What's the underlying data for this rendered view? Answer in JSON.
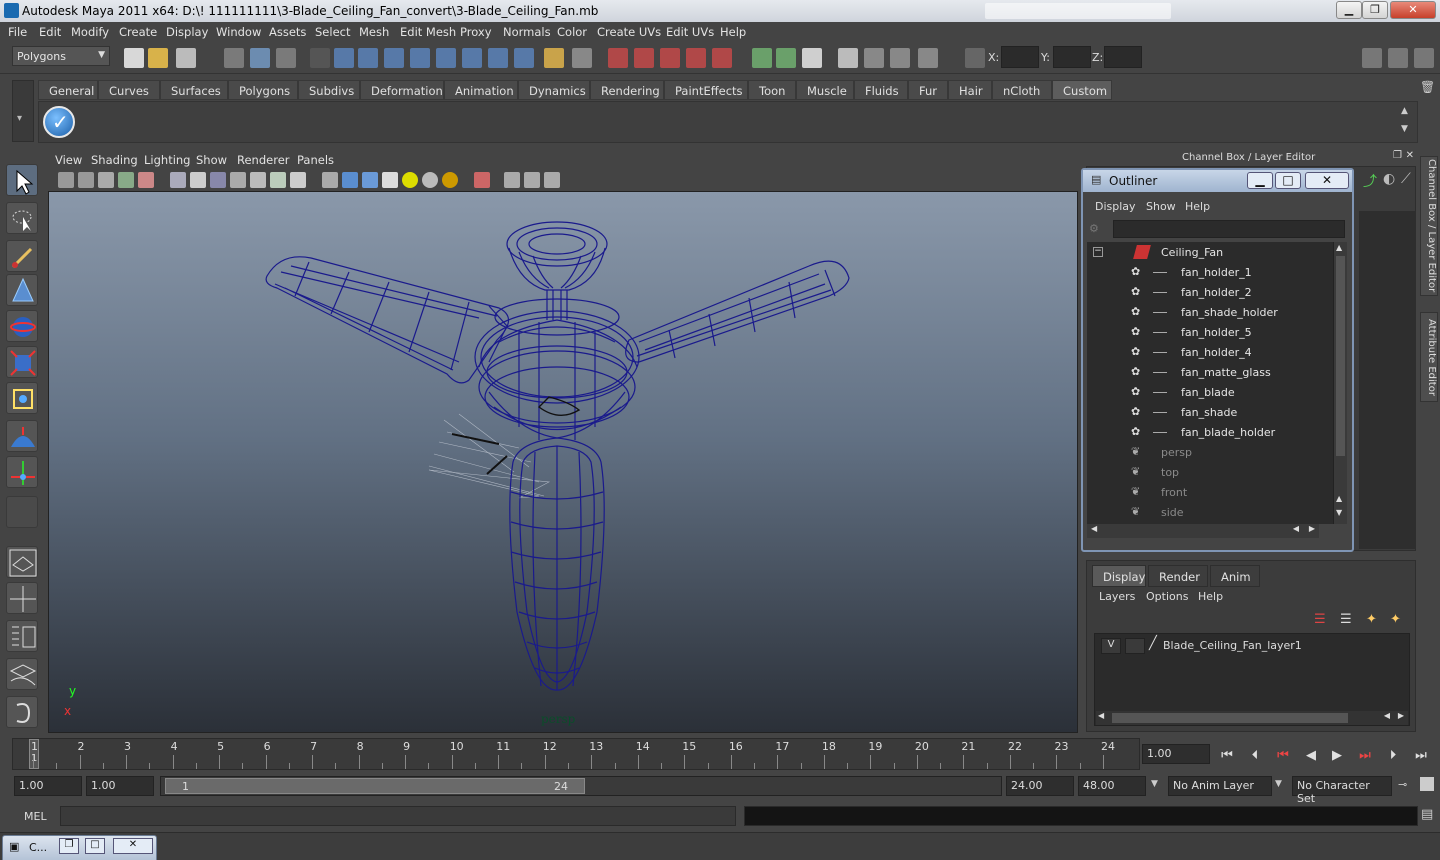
{
  "window": {
    "title": "Autodesk Maya 2011 x64: D:\\! 111111111\\3-Blade_Ceiling_Fan_convert\\3-Blade_Ceiling_Fan.mb",
    "minimize": "▁",
    "maximize": "❐",
    "close": "✕"
  },
  "menubar": [
    "File",
    "Edit",
    "Modify",
    "Create",
    "Display",
    "Window",
    "Assets",
    "Select",
    "Mesh",
    "Edit Mesh",
    "Proxy",
    "Normals",
    "Color",
    "Create UVs",
    "Edit UVs",
    "Help"
  ],
  "statusline": {
    "mode_menu": "Polygons",
    "x_label": "X:",
    "y_label": "Y:",
    "z_label": "Z:"
  },
  "shelf": {
    "tabs": [
      "General",
      "Curves",
      "Surfaces",
      "Polygons",
      "Subdivs",
      "Deformation",
      "Animation",
      "Dynamics",
      "Rendering",
      "PaintEffects",
      "Toon",
      "Muscle",
      "Fluids",
      "Fur",
      "Hair",
      "nCloth",
      "Custom"
    ],
    "active_tab": "Custom"
  },
  "viewport": {
    "menu": [
      "View",
      "Shading",
      "Lighting",
      "Show",
      "Renderer",
      "Panels"
    ],
    "camera_label": "persp",
    "axis_y": "y",
    "axis_x": "x"
  },
  "channel_box": {
    "title": "Channel Box / Layer Editor"
  },
  "outliner": {
    "title": "Outliner",
    "minimize": "▁",
    "maximize": "□",
    "close": "✕",
    "menu": [
      "Display",
      "Show",
      "Help"
    ],
    "root": "Ceiling_Fan",
    "children": [
      "fan_holder_1",
      "fan_holder_2",
      "fan_shade_holder",
      "fan_holder_5",
      "fan_holder_4",
      "fan_matte_glass",
      "fan_blade",
      "fan_shade",
      "fan_blade_holder"
    ],
    "cameras": [
      "persp",
      "top",
      "front",
      "side"
    ]
  },
  "side_tabs": [
    "Channel Box / Layer Editor",
    "Attribute Editor"
  ],
  "layer_editor": {
    "tabs": [
      "Display",
      "Render",
      "Anim"
    ],
    "active_tab": "Display",
    "menu": [
      "Layers",
      "Options",
      "Help"
    ],
    "layers": [
      {
        "visible": "V",
        "name": "Blade_Ceiling_Fan_layer1"
      }
    ]
  },
  "timeline": {
    "ticks": [
      "1",
      "2",
      "3",
      "4",
      "5",
      "6",
      "7",
      "8",
      "9",
      "10",
      "11",
      "12",
      "13",
      "14",
      "15",
      "16",
      "17",
      "18",
      "19",
      "20",
      "21",
      "22",
      "23",
      "24"
    ],
    "current_frame_marker": "1",
    "current_time": "1.00"
  },
  "range": {
    "start_time": "1.00",
    "playback_start": "1.00",
    "slider_start": "1",
    "slider_end": "24",
    "playback_end": "24.00",
    "end_time": "48.00",
    "anim_layer": "No Anim Layer",
    "character_set": "No Character Set"
  },
  "command_line": {
    "label": "MEL"
  },
  "taskbar": {
    "window_label": "C..."
  }
}
